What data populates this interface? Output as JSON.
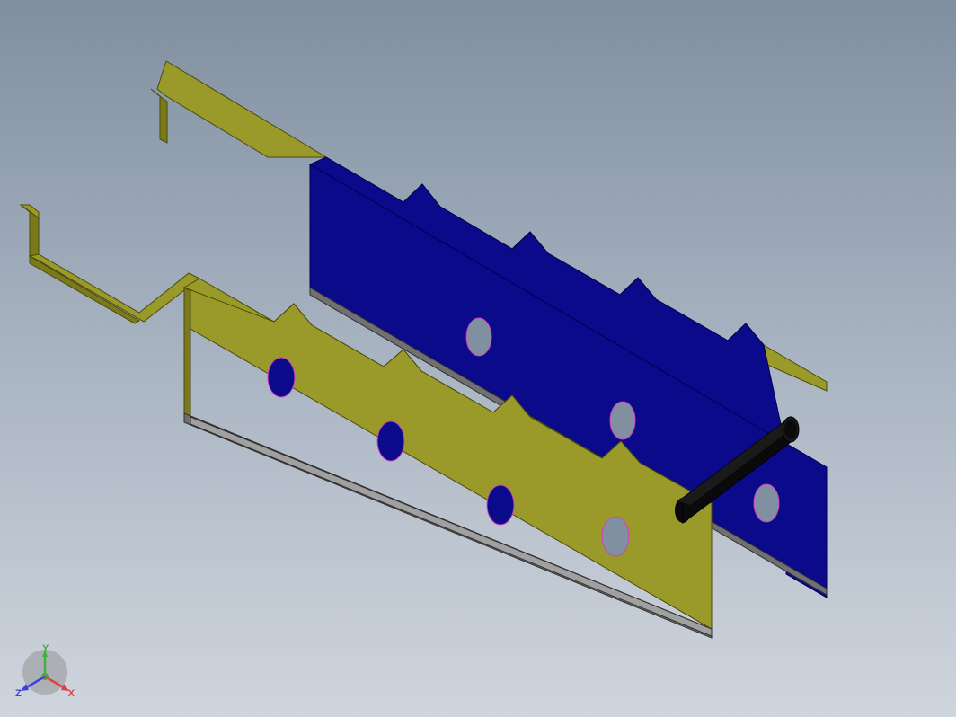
{
  "axes": {
    "x": "X",
    "y": "Y",
    "z": "Z"
  },
  "model": {
    "colors": {
      "olive_front": "#9a9a2a",
      "olive_shade": "#7a7a1a",
      "blue_back": "#0a0a8a",
      "gray_edge": "#707070",
      "black_pin": "#0a0a0a",
      "magenta_accent": "#d040c0"
    }
  }
}
